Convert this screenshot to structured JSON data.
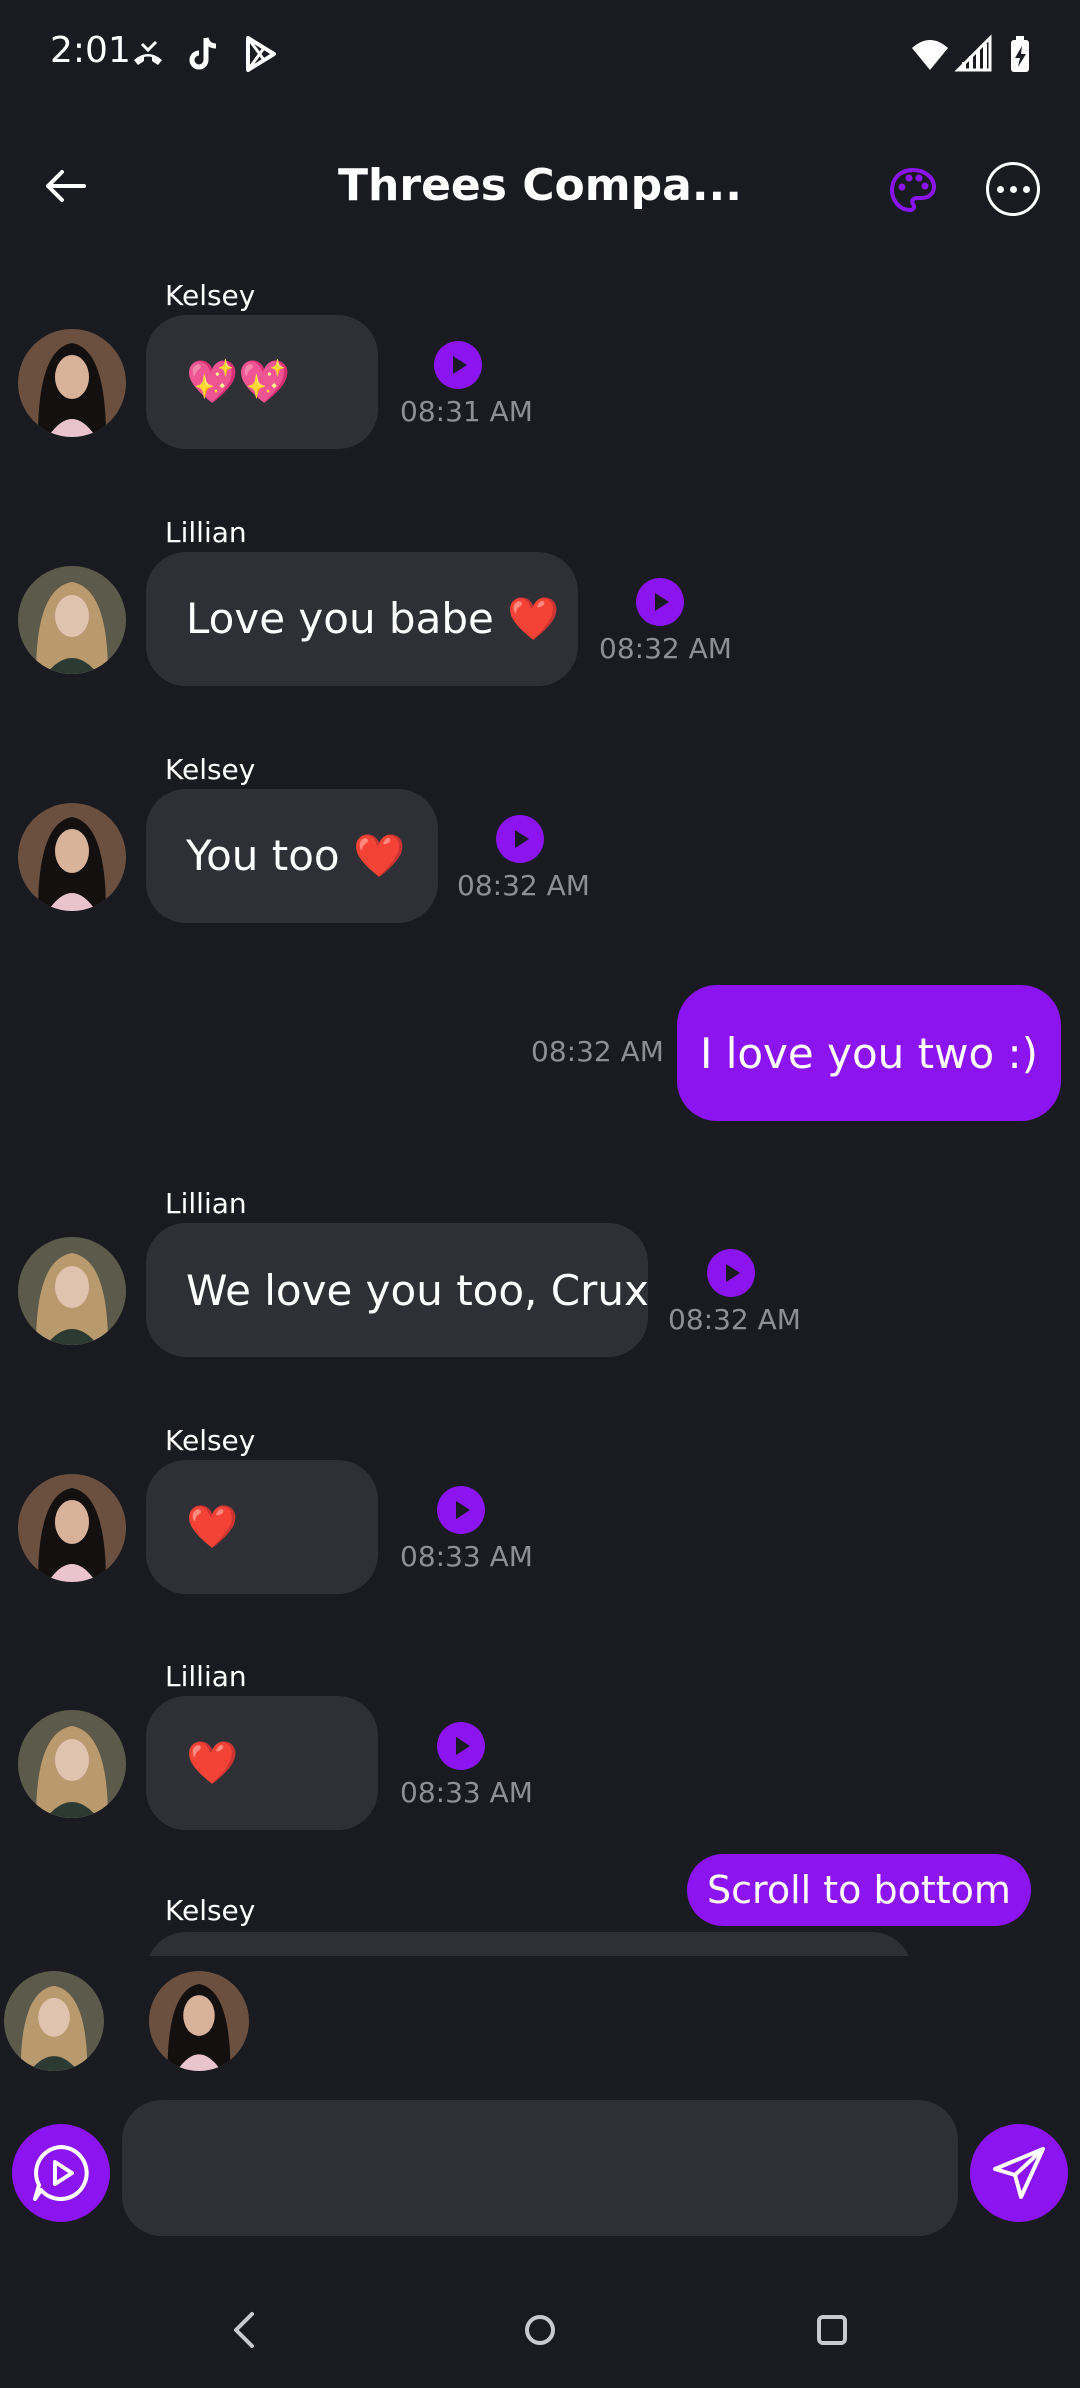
{
  "status_bar": {
    "time": "2:01"
  },
  "header": {
    "title": "Threes Compa..."
  },
  "messages": [
    {
      "sender": "Kelsey",
      "text": "💖💖",
      "time": "08:31 AM"
    },
    {
      "sender": "Lillian",
      "text": "Love you babe ❤️",
      "time": "08:32 AM"
    },
    {
      "sender": "Kelsey",
      "text": "You too ❤️",
      "time": "08:32 AM"
    },
    {
      "sender": "Lillian",
      "text": "We love you too, Crux",
      "time": "08:32 AM"
    },
    {
      "sender": "Kelsey",
      "text": "❤️",
      "time": "08:33 AM"
    },
    {
      "sender": "Lillian",
      "text": "❤️",
      "time": "08:33 AM"
    },
    {
      "sender": "Kelsey",
      "text": "",
      "time": ""
    }
  ],
  "sent_message": {
    "text": "I love you two :)",
    "time": "08:32 AM"
  },
  "scroll_button": {
    "label": "Scroll to bottom"
  },
  "composer": {
    "placeholder": ""
  },
  "icons": {
    "back": "arrow-left-icon",
    "palette": "palette-icon",
    "more": "more-horizontal-icon",
    "play": "play-icon",
    "voice": "voice-chat-icon",
    "send": "send-icon"
  },
  "colors": {
    "accent": "#8b14f0",
    "bubble": "#2e3036",
    "background": "#1a1b20"
  }
}
